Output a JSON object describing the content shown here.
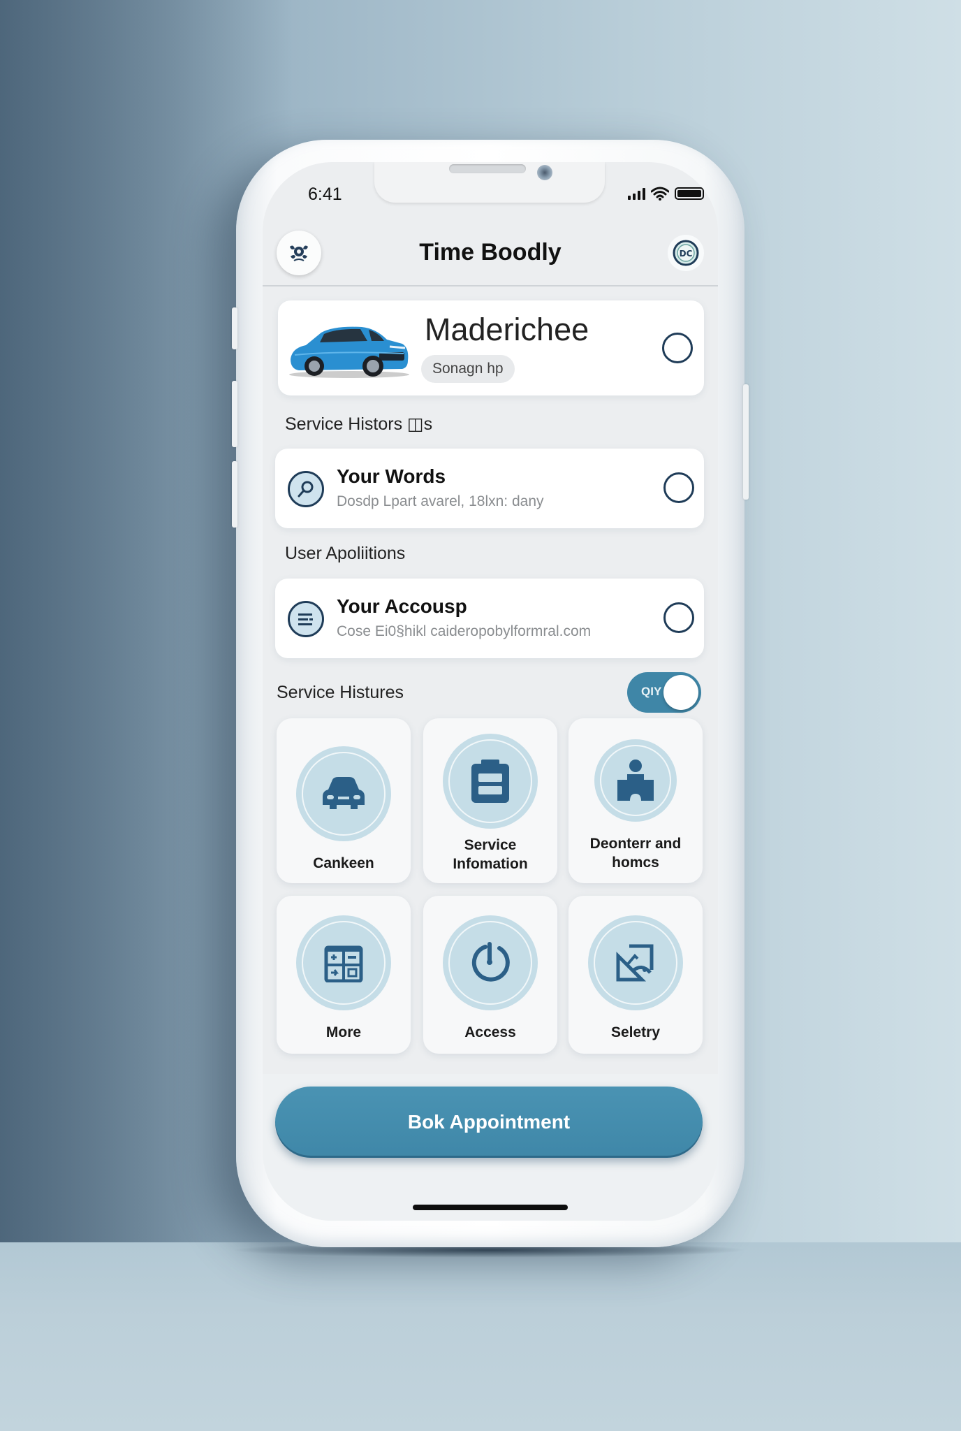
{
  "status_bar": {
    "time": "6:41"
  },
  "header": {
    "title": "Time Boodly",
    "left_icon": "emblem-icon",
    "right_icon": "badge-icon"
  },
  "vehicle": {
    "name": "Maderichee",
    "chip": "Sonagn hp",
    "image": "blue-car"
  },
  "sections": {
    "service_history_label": "Service Histors ◫s",
    "user_applications_label": "User Apoliitions",
    "service_histures_label": "Service Histures"
  },
  "list_items": [
    {
      "title": "Your Words",
      "subtitle": "Dosdp Lpart avarel, 18lxn: dany",
      "icon": "search-person-icon"
    },
    {
      "title": "Your Accousp",
      "subtitle": "Cose Ei0§hikl caideropobylformral.com",
      "icon": "menu-list-icon"
    }
  ],
  "toggle": {
    "label": "QIY",
    "state": "on"
  },
  "tiles": [
    {
      "label": "Cankeen",
      "icon": "car-icon"
    },
    {
      "label": "Service Infomation",
      "icon": "clipboard-icon"
    },
    {
      "label": "Deonterr and homcs",
      "icon": "person-building-icon"
    },
    {
      "label": "More",
      "icon": "calendar-grid-icon"
    },
    {
      "label": "Access",
      "icon": "power-icon"
    },
    {
      "label": "Seletry",
      "icon": "edit-document-icon"
    }
  ],
  "cta": {
    "label": "Bok Appointment"
  },
  "colors": {
    "accent": "#3f87a8",
    "icon_dark": "#1f4e72",
    "tile_circle": "#c5dde7"
  }
}
